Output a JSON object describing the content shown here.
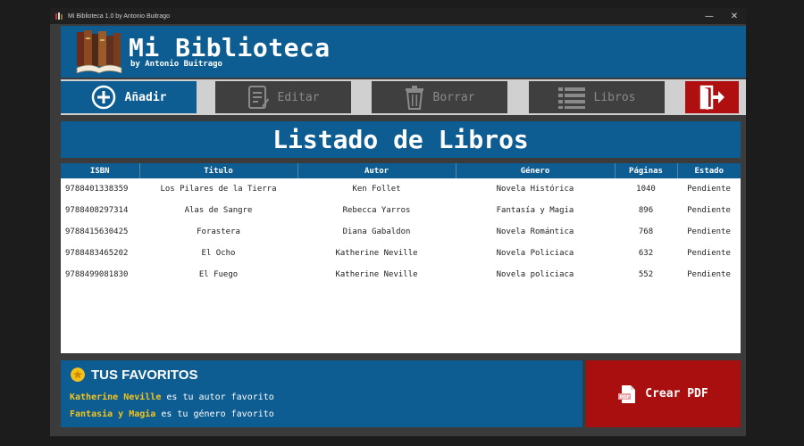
{
  "window": {
    "title": "Mi Biblioteca 1.0 by Antonio Buitrago",
    "minimize_glyph": "—",
    "close_glyph": "✕"
  },
  "header": {
    "title": "Mi Biblioteca",
    "subtitle": "by Antonio Buitrago",
    "logo_icon": "books-icon"
  },
  "toolbar": {
    "add_label": "Añadir",
    "edit_label": "Editar",
    "delete_label": "Borrar",
    "books_label": "Libros",
    "add_icon": "plus-circle-icon",
    "edit_icon": "edit-document-icon",
    "delete_icon": "trash-icon",
    "books_icon": "list-icon",
    "exit_icon": "exit-door-icon"
  },
  "banner": {
    "title": "Listado de Libros"
  },
  "table": {
    "columns": [
      "ISBN",
      "Titulo",
      "Autor",
      "Género",
      "Páginas",
      "Estado"
    ],
    "rows": [
      [
        "9788401338359",
        "Los Pilares de la Tierra",
        "Ken Follet",
        "Novela Histórica",
        "1040",
        "Pendiente"
      ],
      [
        "9788408297314",
        "Alas de Sangre",
        "Rebecca Yarros",
        "Fantasía y Magia",
        "896",
        "Pendiente"
      ],
      [
        "9788415630425",
        "Forastera",
        "Diana Gabaldon",
        "Novela Romántica",
        "768",
        "Pendiente"
      ],
      [
        "9788483465202",
        "El Ocho",
        "Katherine Neville",
        "Novela Policiaca",
        "632",
        "Pendiente"
      ],
      [
        "9788499081830",
        "El Fuego",
        "Katherine Neville",
        "Novela policiaca",
        "552",
        "Pendiente"
      ]
    ]
  },
  "favorites": {
    "title": "TUS FAVORITOS",
    "icon": "star-icon",
    "author": "Katherine Neville",
    "author_suffix": " es tu autor favorito",
    "genre": "Fantasia y Magia",
    "genre_suffix": " es tu género favorito"
  },
  "pdf": {
    "label": "Crear PDF",
    "icon": "pdf-icon"
  },
  "colors": {
    "primary": "#0e5d92",
    "danger": "#b00f0f",
    "highlight": "#f4c21b",
    "disabled": "#3f3f3f"
  }
}
